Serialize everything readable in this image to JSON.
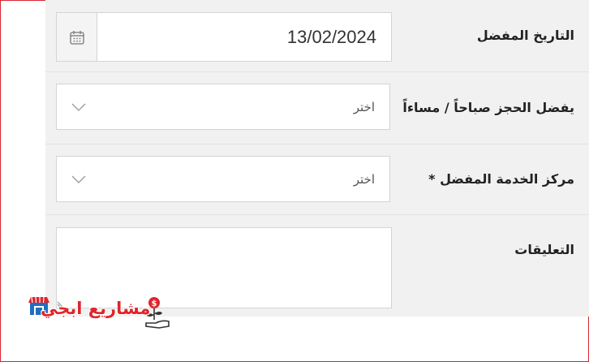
{
  "form": {
    "date": {
      "label": "التاريخ المفضل",
      "value": "13/02/2024",
      "icon": "calendar-icon"
    },
    "time_pref": {
      "label": "يفضل الحجز صباحاً / مساءاً",
      "value": "اختر",
      "icon": "chevron-down-icon"
    },
    "service_center": {
      "label": "مركز الخدمة المفضل *",
      "value": "اختر",
      "icon": "chevron-down-icon"
    },
    "comments": {
      "label": "التعليقات",
      "value": ""
    }
  },
  "logo": {
    "text": "مشاريع ابجي"
  },
  "colors": {
    "frame_border": "#d8262f",
    "form_bg": "#f1f1f1",
    "logo_red": "#e0252b",
    "logo_blue": "#1e6fc0"
  }
}
